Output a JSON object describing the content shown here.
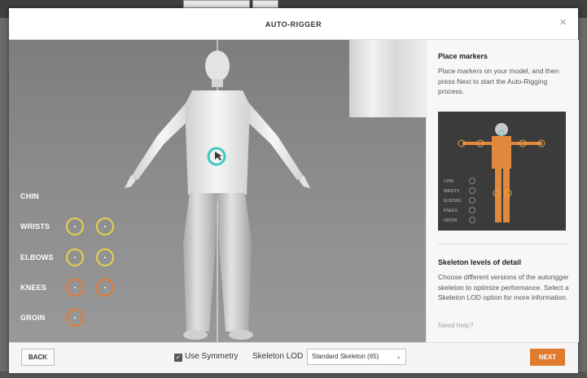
{
  "dialog": {
    "title": "AUTO-RIGGER",
    "close_symbol": "×"
  },
  "markers": [
    {
      "label": "CHIN",
      "circles": []
    },
    {
      "label": "WRISTS",
      "circles": [
        "#e8d24a",
        "#e8d24a"
      ]
    },
    {
      "label": "ELBOWS",
      "circles": [
        "#e8d24a",
        "#e8d24a"
      ]
    },
    {
      "label": "KNEES",
      "circles": [
        "#e57a35",
        "#e57a35"
      ]
    },
    {
      "label": "GROIN",
      "circles": [
        "#e57a35"
      ]
    }
  ],
  "side_panel": {
    "place_markers": {
      "title": "Place markers",
      "text": "Place markers on your model, and then press Next to start the Auto-Rigging process."
    },
    "preview_labels": [
      "CHIN",
      "WRISTS",
      "ELBOWS",
      "KNEES",
      "GROIN"
    ],
    "lod": {
      "title": "Skeleton levels of detail",
      "text": "Choose different versions of the autorigger skeleton to optimize performance. Select a Skeleton LOD option for more information."
    },
    "help_link": "Need help?"
  },
  "footer": {
    "back_label": "BACK",
    "symmetry_label": "Use Symmetry",
    "symmetry_checked": true,
    "lod_label": "Skeleton LOD",
    "lod_selected": "Standard Skeleton (65)",
    "next_label": "NEXT"
  },
  "colors": {
    "accent": "#e07b2d",
    "marker_yellow": "#e8d24a",
    "marker_orange": "#e57a35",
    "chin_marker": "#3fc9c4"
  }
}
